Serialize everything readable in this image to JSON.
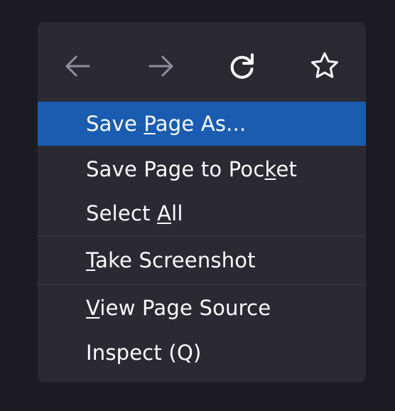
{
  "menu": {
    "nav": [
      {
        "name": "back-icon",
        "label": "Back"
      },
      {
        "name": "forward-icon",
        "label": "Forward"
      },
      {
        "name": "reload-icon",
        "label": "Reload"
      },
      {
        "name": "star-icon",
        "label": "Bookmark this page"
      }
    ],
    "items": [
      {
        "before": "Save ",
        "key": "P",
        "after": "age As..."
      },
      {
        "before": "Save Page to Poc",
        "key": "k",
        "after": "et"
      },
      {
        "before": "Select ",
        "key": "A",
        "after": "ll"
      },
      {
        "before": "",
        "key": "T",
        "after": "ake Screenshot"
      },
      {
        "before": "",
        "key": "V",
        "after": "iew Page Source"
      },
      {
        "before": "Inspect (Q)",
        "key": "",
        "after": ""
      }
    ]
  },
  "colors": {
    "page_background": "#1c1b22",
    "menu_background": "#2b2a33",
    "highlight": "#1a5cb0",
    "text": "#fbfbfe",
    "icon": "#8f8f9d"
  }
}
